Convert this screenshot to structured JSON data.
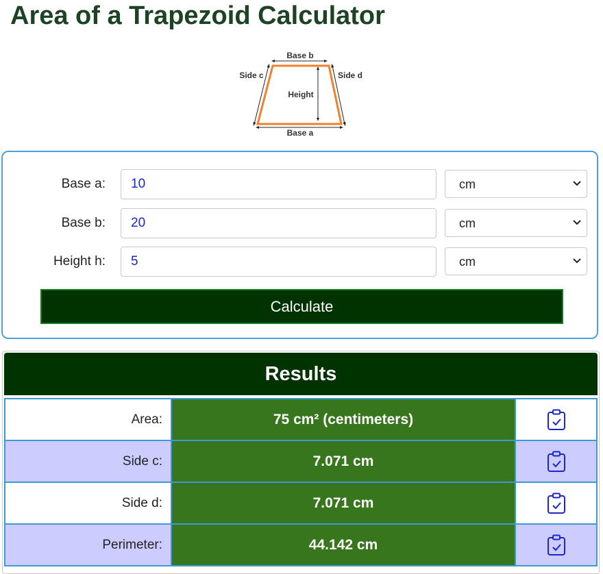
{
  "page_title": "Area of a Trapezoid Calculator",
  "diagram": {
    "labels": {
      "base_b": "Base b",
      "base_a": "Base a",
      "side_c": "Side c",
      "side_d": "Side d",
      "height": "Height"
    },
    "shape_color": "#f07f2a"
  },
  "form": {
    "rows": [
      {
        "label": "Base a:",
        "value": "10",
        "unit": "cm"
      },
      {
        "label": "Base b:",
        "value": "20",
        "unit": "cm"
      },
      {
        "label": "Height h:",
        "value": "5",
        "unit": "cm"
      }
    ],
    "calculate_label": "Calculate"
  },
  "results": {
    "title": "Results",
    "rows": [
      {
        "label": "Area:",
        "value": "75 cm² (centimeters)"
      },
      {
        "label": "Side c:",
        "value": "7.071 cm"
      },
      {
        "label": "Side d:",
        "value": "7.071 cm"
      },
      {
        "label": "Perimeter:",
        "value": "44.142 cm"
      }
    ],
    "copy_icon": "clipboard-check-icon"
  },
  "colors": {
    "title": "#1d4325",
    "dark_green": "#003300",
    "value_green": "#38761d",
    "row_alt": "#ccccff",
    "border_blue": "#3d9ad6",
    "input_text": "#1b25c9"
  }
}
